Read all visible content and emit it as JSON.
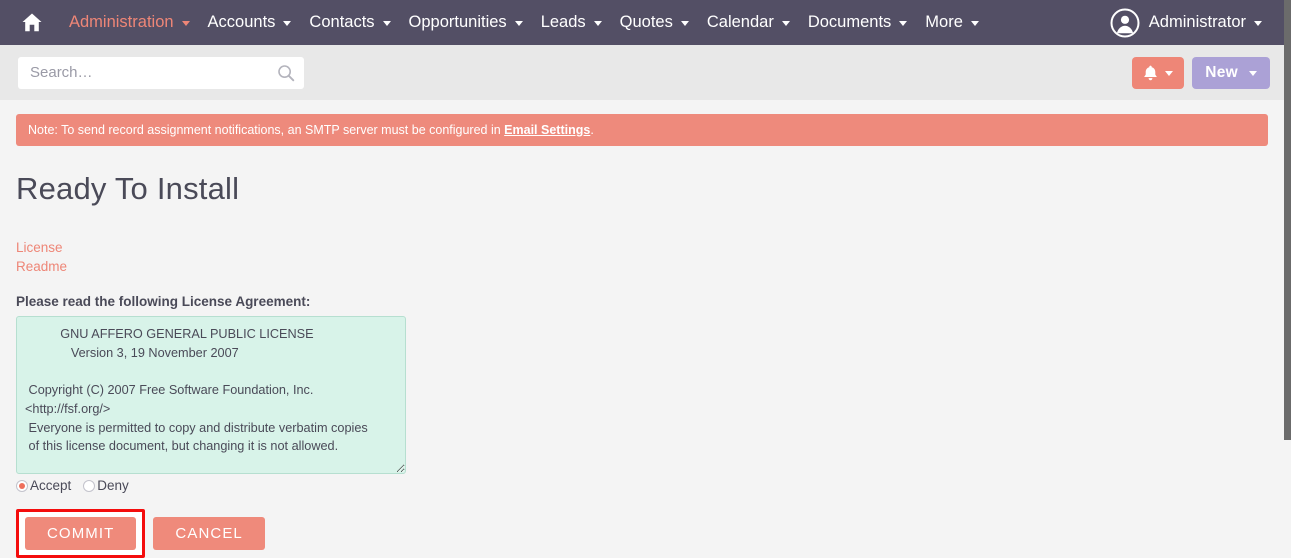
{
  "navbar": {
    "home_label": "Home",
    "items": [
      {
        "label": "Administration",
        "active": true
      },
      {
        "label": "Accounts",
        "active": false
      },
      {
        "label": "Contacts",
        "active": false
      },
      {
        "label": "Opportunities",
        "active": false
      },
      {
        "label": "Leads",
        "active": false
      },
      {
        "label": "Quotes",
        "active": false
      },
      {
        "label": "Calendar",
        "active": false
      },
      {
        "label": "Documents",
        "active": false
      },
      {
        "label": "More",
        "active": false
      }
    ],
    "user_label": "Administrator",
    "bg_color": "#534f65",
    "active_color": "#ee8677"
  },
  "subbar": {
    "search_placeholder": "Search…",
    "search_value": "",
    "notifications_label": "",
    "new_label": "New",
    "bell_color": "#ee8677",
    "new_color": "#aba1d6"
  },
  "alert": {
    "text_before": "Note: To send record assignment notifications, an SMTP server must be configured in ",
    "link_label": "Email Settings",
    "text_after": ".",
    "bg_color": "#ee8a7c"
  },
  "main": {
    "page_title": "Ready To Install",
    "links": [
      {
        "label": "License"
      },
      {
        "label": "Readme"
      }
    ],
    "license_label": "Please read the following License Agreement:",
    "license_text": "          GNU AFFERO GENERAL PUBLIC LICENSE\n             Version 3, 19 November 2007\n\n Copyright (C) 2007 Free Software Foundation, Inc.\n<http://fsf.org/>\n Everyone is permitted to copy and distribute verbatim copies\n of this license document, but changing it is not allowed.\n\n                      Preamble",
    "radios": [
      {
        "label": "Accept",
        "checked": true
      },
      {
        "label": "Deny",
        "checked": false
      }
    ],
    "commit_label": "COMMIT",
    "cancel_label": "CANCEL",
    "button_color": "#ef8a7b",
    "highlight_color": "#f40d0d"
  }
}
